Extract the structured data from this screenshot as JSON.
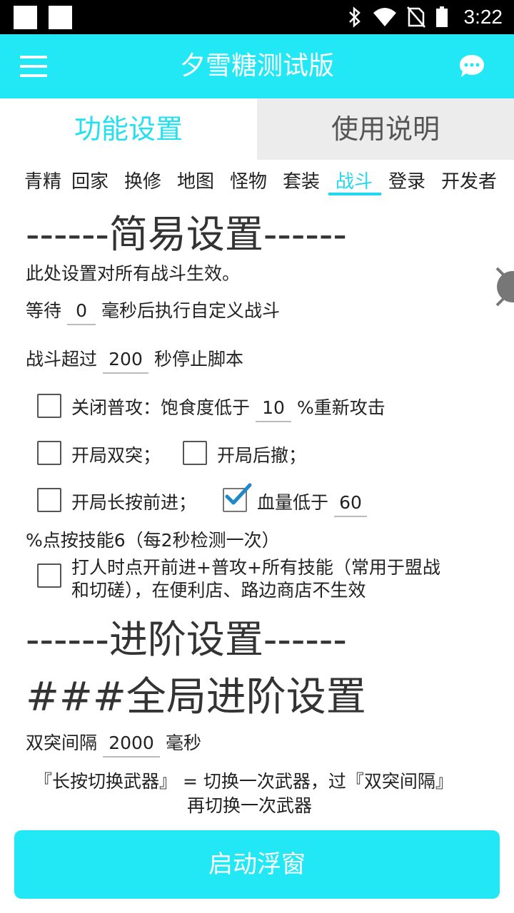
{
  "status_bar": {
    "time": "3:22"
  },
  "app_bar": {
    "title": "夕雪糖测试版",
    "menu_icon": "hamburger-menu-icon",
    "chat_icon": "chat-bubble-icon"
  },
  "main_tabs": [
    {
      "label": "功能设置",
      "active": true
    },
    {
      "label": "使用说明",
      "active": false
    }
  ],
  "sub_tabs": [
    {
      "label": "青精"
    },
    {
      "label": "回家"
    },
    {
      "label": "换修"
    },
    {
      "label": "地图"
    },
    {
      "label": "怪物"
    },
    {
      "label": "套装"
    },
    {
      "label": "战斗",
      "active": true
    },
    {
      "label": "登录"
    },
    {
      "label": "开发者"
    }
  ],
  "simple": {
    "heading": "------简易设置------",
    "desc": "此处设置对所有战斗生效。",
    "wait_prefix": "等待",
    "wait_value": "0",
    "wait_suffix": "毫秒后执行自定义战斗",
    "timeout_prefix": "战斗超过",
    "timeout_value": "200",
    "timeout_suffix": "秒停止脚本",
    "close_attack_label": "关闭普攻：饱食度低于",
    "hunger_value": "10",
    "hunger_suffix": "%重新攻击",
    "double_dash_label": "开局双突；",
    "retreat_label": "开局后撤；",
    "long_press_label": "开局长按前进；",
    "hp_label": "血量低于",
    "hp_value": "60",
    "hp_suffix": "%点按技能6（每2秒检测一次）",
    "hit_all_line1": "打人时点开前进+普攻+所有技能（常用于盟战",
    "hit_all_line2": "和切磋），在便利店、路边商店不生效"
  },
  "advanced": {
    "heading": "------进阶设置------",
    "global_heading": "###全局进阶设置",
    "interval_prefix": "双突间隔",
    "interval_value": "2000",
    "interval_suffix": "毫秒",
    "switch_line1": "『长按切换武器』 = 切换一次武器，过『双突间隔』",
    "switch_line2": "再切换一次武器"
  },
  "start_button": "启动浮窗",
  "colors": {
    "accent": "#22e8f6",
    "tab_active_text": "#22e0f0",
    "checkmark": "#1e88c8"
  }
}
